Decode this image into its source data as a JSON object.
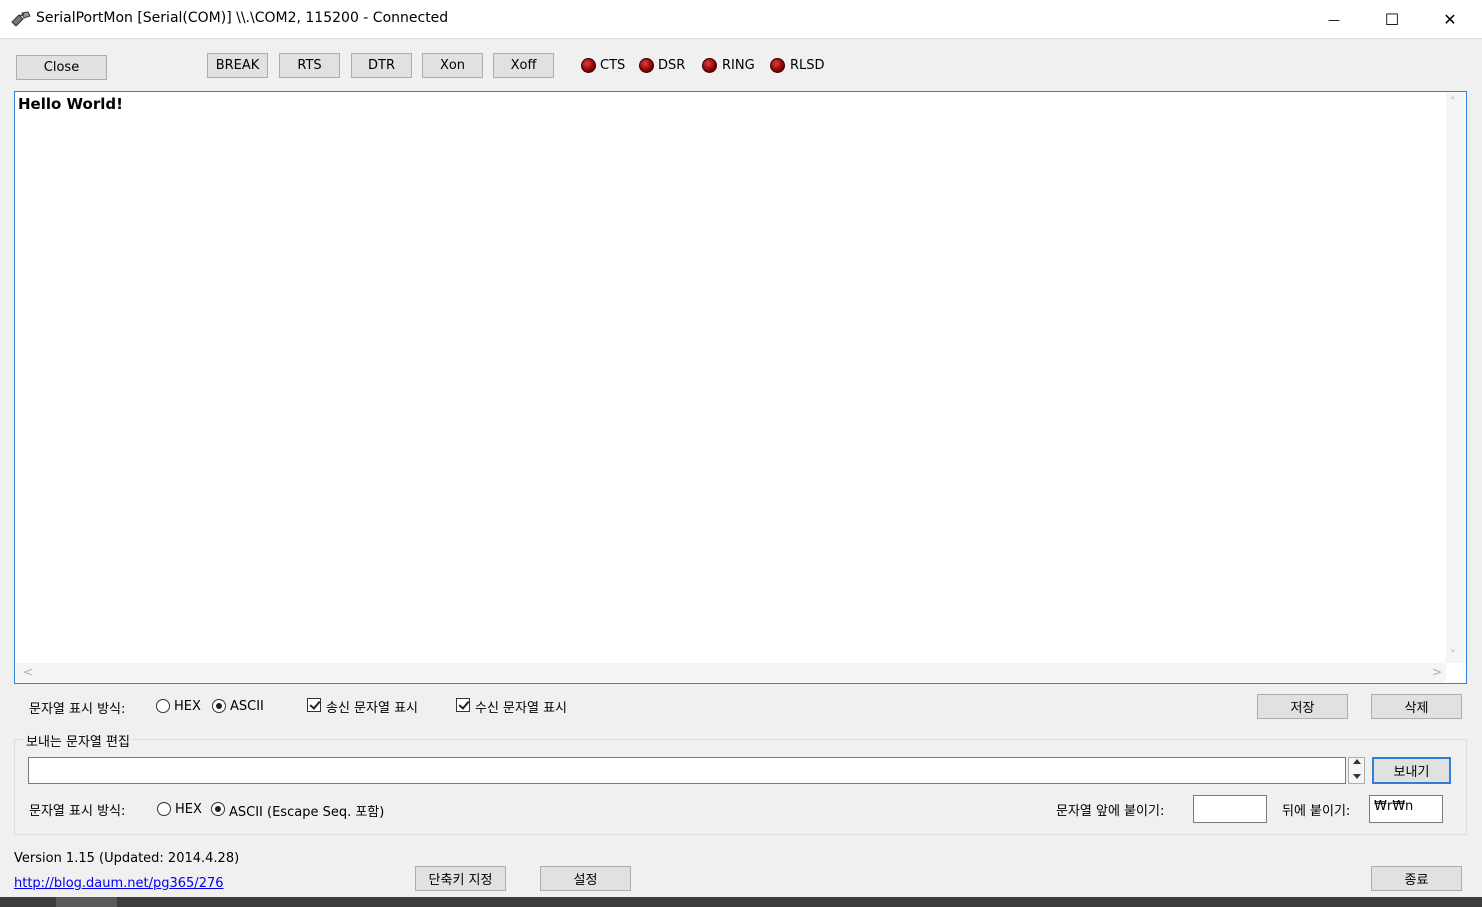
{
  "window": {
    "title": "SerialPortMon [Serial(COM)] \\\\.\\COM2, 115200 - Connected",
    "minimize_glyph": "—",
    "maximize_glyph": "☐",
    "close_glyph": "✕",
    "icon": "plug-icon"
  },
  "toolbar": {
    "close_label": "Close",
    "break_label": "BREAK",
    "rts_label": "RTS",
    "dtr_label": "DTR",
    "xon_label": "Xon",
    "xoff_label": "Xoff"
  },
  "signals": [
    {
      "label": "CTS",
      "color": "#b00000"
    },
    {
      "label": "DSR",
      "color": "#b00000"
    },
    {
      "label": "RING",
      "color": "#b00000"
    },
    {
      "label": "RLSD",
      "color": "#b00000"
    }
  ],
  "log": {
    "content": "Hello World!",
    "scroll_up": "˄",
    "scroll_down": "˅",
    "scroll_left": "<",
    "scroll_right": ">"
  },
  "display_options": {
    "format_label": "문자열 표시 방식:",
    "hex_label": "HEX",
    "ascii_label": "ASCII",
    "selected": "ASCII",
    "show_sent_label": "송신 문자열 표시",
    "show_sent_checked": true,
    "show_received_label": "수신 문자열 표시",
    "show_received_checked": true,
    "save_label": "저장",
    "delete_label": "삭제"
  },
  "send_group": {
    "title": "보내는 문자열 편집",
    "input_value": "",
    "send_label": "보내기",
    "format_label": "문자열 표시 방식:",
    "hex_label": "HEX",
    "ascii_label": "ASCII (Escape Seq. 포함)",
    "selected": "ASCII",
    "prefix_label": "문자열 앞에 붙이기:",
    "prefix_value": "",
    "suffix_label": "뒤에 붙이기:",
    "suffix_value": "₩r₩n"
  },
  "footer": {
    "version": "Version 1.15 (Updated: 2014.4.28)",
    "link": "http://blog.daum.net/pg365/276",
    "shortcut_label": "단축키 지정",
    "settings_label": "설정",
    "exit_label": "종료"
  }
}
